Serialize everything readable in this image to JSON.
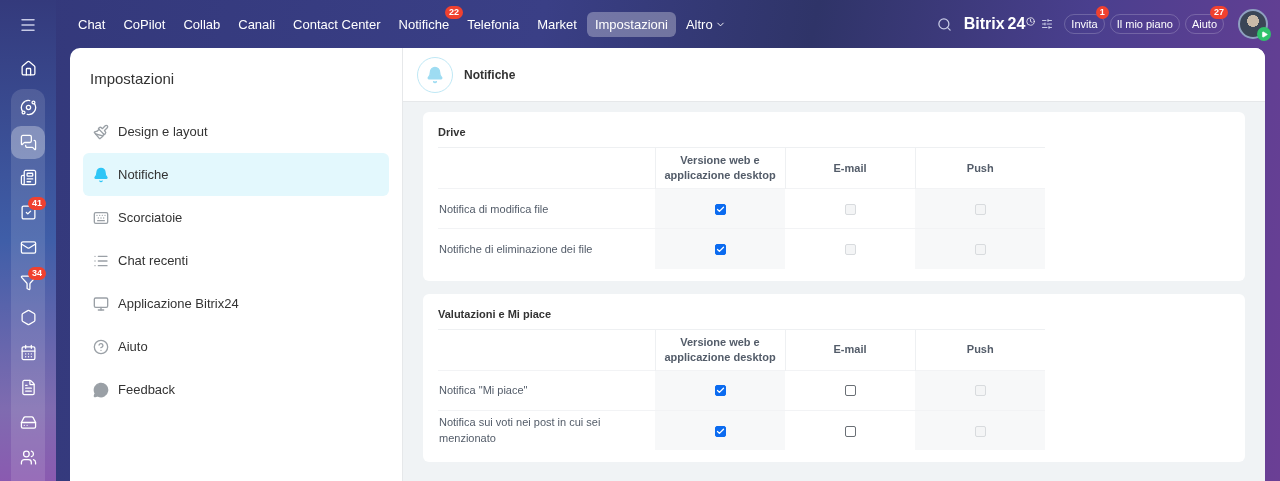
{
  "rail": {
    "menu_selected": false,
    "pinned": [
      {
        "kind": "home",
        "selected": false
      }
    ],
    "items": [
      {
        "kind": "copilot",
        "selected": false
      },
      {
        "kind": "chat",
        "selected": true
      },
      {
        "kind": "feed",
        "selected": false
      },
      {
        "kind": "tasks",
        "selected": false,
        "badge": "41"
      },
      {
        "kind": "mail",
        "selected": false
      },
      {
        "kind": "crm",
        "selected": false,
        "badge": "34"
      },
      {
        "kind": "sites",
        "selected": false
      },
      {
        "kind": "calendar",
        "selected": false
      },
      {
        "kind": "docs",
        "selected": false
      },
      {
        "kind": "drive",
        "selected": false
      },
      {
        "kind": "people",
        "selected": false
      }
    ]
  },
  "topnav": {
    "items": [
      {
        "label": "Chat",
        "selected": false
      },
      {
        "label": "CoPilot",
        "selected": false
      },
      {
        "label": "Collab",
        "selected": false
      },
      {
        "label": "Canali",
        "selected": false
      },
      {
        "label": "Contact Center",
        "selected": false
      },
      {
        "label": "Notifiche",
        "selected": false,
        "badge": "22"
      },
      {
        "label": "Telefonia",
        "selected": false
      },
      {
        "label": "Market",
        "selected": false
      },
      {
        "label": "Impostazioni",
        "selected": true
      },
      {
        "label": "Altro",
        "selected": false,
        "dropdown": true
      }
    ],
    "logo": {
      "name": "Bitrix",
      "number": "24"
    },
    "buttons": [
      {
        "label": "Invita",
        "badge": "1"
      },
      {
        "label": "Il mio piano"
      },
      {
        "label": "Aiuto",
        "badge": "27"
      }
    ]
  },
  "settings": {
    "title": "Impostazioni",
    "items": [
      {
        "label": "Design e layout",
        "kind": "brush",
        "selected": false
      },
      {
        "label": "Notifiche",
        "kind": "bell",
        "selected": true
      },
      {
        "label": "Scorciatoie",
        "kind": "keyboard",
        "selected": false
      },
      {
        "label": "Chat recenti",
        "kind": "list",
        "selected": false
      },
      {
        "label": "Applicazione Bitrix24",
        "kind": "monitor",
        "selected": false
      },
      {
        "label": "Aiuto",
        "kind": "help",
        "selected": false
      },
      {
        "label": "Feedback",
        "kind": "feedback",
        "selected": false
      }
    ]
  },
  "content": {
    "title": "Notifiche",
    "sections": [
      {
        "title": "Drive",
        "columns": [
          "Versione web e applicazione desktop",
          "E-mail",
          "Push"
        ],
        "rows": [
          {
            "label": "Notifica di modifica file",
            "cells": [
              {
                "checked": true,
                "disabled": false
              },
              {
                "checked": false,
                "disabled": true
              },
              {
                "checked": false,
                "disabled": true
              }
            ]
          },
          {
            "label": "Notifiche di eliminazione dei file",
            "cells": [
              {
                "checked": true,
                "disabled": false
              },
              {
                "checked": false,
                "disabled": true
              },
              {
                "checked": false,
                "disabled": true
              }
            ]
          }
        ]
      },
      {
        "title": "Valutazioni e Mi piace",
        "columns": [
          "Versione web e applicazione desktop",
          "E-mail",
          "Push"
        ],
        "rows": [
          {
            "label": "Notifica \"Mi piace\"",
            "cells": [
              {
                "checked": true,
                "disabled": false
              },
              {
                "checked": false,
                "disabled": false
              },
              {
                "checked": false,
                "disabled": true
              }
            ]
          },
          {
            "label": "Notifica sui voti nei post in cui sei menzionato",
            "cells": [
              {
                "checked": true,
                "disabled": false
              },
              {
                "checked": false,
                "disabled": false
              },
              {
                "checked": false,
                "disabled": true
              }
            ]
          }
        ]
      }
    ]
  }
}
